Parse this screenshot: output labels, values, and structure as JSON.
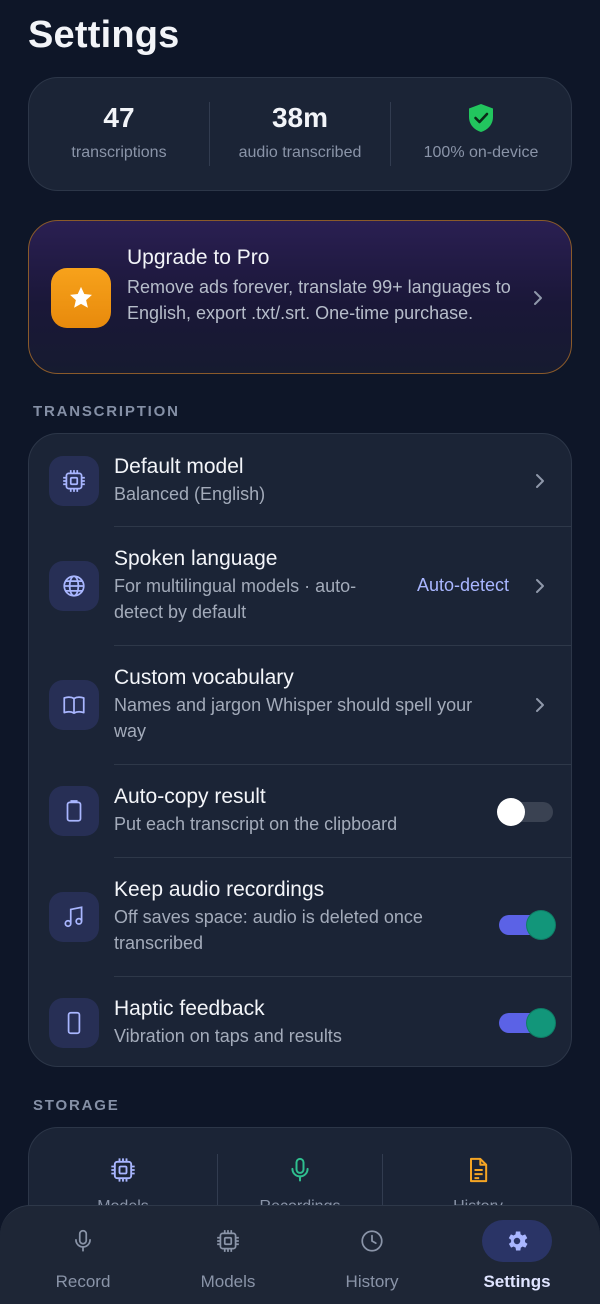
{
  "header": {
    "title": "Settings"
  },
  "stats": [
    {
      "value": "47",
      "label": "transcriptions"
    },
    {
      "value": "38m",
      "label": "audio transcribed"
    },
    {
      "icon": "shield-check-icon",
      "label": "100% on-device"
    }
  ],
  "pro": {
    "title": "Upgrade to Pro",
    "description": "Remove ads forever, translate 99+ languages to English, export .txt/.srt. One-time purchase.",
    "icon": "star-icon"
  },
  "sections": {
    "transcription": "TRANSCRIPTION",
    "storage": "STORAGE"
  },
  "transcription_rows": [
    {
      "title": "Default model",
      "subtitle": "Balanced (English)",
      "icon": "chip-icon",
      "control": "chevron"
    },
    {
      "title": "Spoken language",
      "subtitle": "For multilingual models · auto-detect by default",
      "value": "Auto-detect",
      "icon": "globe-icon",
      "control": "chevron"
    },
    {
      "title": "Custom vocabulary",
      "subtitle": "Names and jargon Whisper should spell your way",
      "icon": "book-icon",
      "control": "chevron"
    },
    {
      "title": "Auto-copy result",
      "subtitle": "Put each transcript on the clipboard",
      "icon": "clipboard-icon",
      "control": "toggle",
      "enabled": false
    },
    {
      "title": "Keep audio recordings",
      "subtitle": "Off saves space: audio is deleted once transcribed",
      "icon": "music-note-icon",
      "control": "toggle",
      "enabled": true
    },
    {
      "title": "Haptic feedback",
      "subtitle": "Vibration on taps and results",
      "icon": "phone-icon",
      "control": "toggle",
      "enabled": true
    }
  ],
  "storage": [
    {
      "label": "Models",
      "icon": "chip-icon"
    },
    {
      "label": "Recordings",
      "icon": "mic-icon"
    },
    {
      "label": "History",
      "icon": "document-icon"
    }
  ],
  "nav": [
    {
      "label": "Record",
      "icon": "mic-icon"
    },
    {
      "label": "Models",
      "icon": "chip-icon"
    },
    {
      "label": "History",
      "icon": "clock-icon"
    },
    {
      "label": "Settings",
      "icon": "gear-icon",
      "active": true
    }
  ],
  "colors": {
    "background": "#0e1628",
    "card": "#1b2436",
    "accent": "#a9b6ff",
    "toggle_track_on": "#5b62e6",
    "toggle_knob_on": "#12967a",
    "pro_icon": "#f7a21b",
    "success": "#22c55e"
  }
}
